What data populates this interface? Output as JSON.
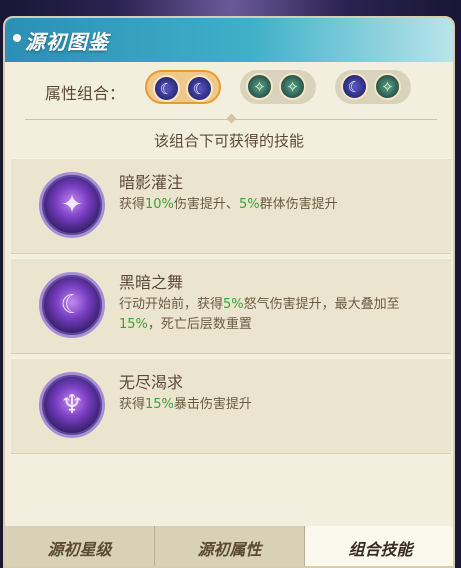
{
  "header": {
    "title": "源初图鉴"
  },
  "attribute": {
    "label": "属性组合：",
    "combos": [
      {
        "orbs": [
          "moon",
          "moon"
        ],
        "selected": true
      },
      {
        "orbs": [
          "star",
          "star"
        ],
        "selected": false
      },
      {
        "orbs": [
          "moon",
          "star"
        ],
        "selected": false
      }
    ]
  },
  "skills": {
    "heading": "该组合下可获得的技能",
    "items": [
      {
        "name": "暗影灌注",
        "icon": "shadow-infusion-icon",
        "desc": [
          {
            "t": "获得"
          },
          {
            "t": "10%",
            "g": true
          },
          {
            "t": "伤害提升、"
          },
          {
            "t": "5%",
            "g": true
          },
          {
            "t": "群体伤害提升"
          }
        ]
      },
      {
        "name": "黑暗之舞",
        "icon": "dark-dance-icon",
        "desc": [
          {
            "t": "行动开始前，获得"
          },
          {
            "t": "5%",
            "g": true
          },
          {
            "t": "怒气伤害提升，最大叠加至"
          },
          {
            "t": "15%",
            "g": true
          },
          {
            "t": "，死亡后层数重置"
          }
        ]
      },
      {
        "name": "无尽渴求",
        "icon": "endless-craving-icon",
        "desc": [
          {
            "t": "获得"
          },
          {
            "t": "15%",
            "g": true
          },
          {
            "t": "暴击伤害提升"
          }
        ]
      }
    ]
  },
  "tabs": [
    {
      "label": "源初星级",
      "active": false
    },
    {
      "label": "源初属性",
      "active": false
    },
    {
      "label": "组合技能",
      "active": true
    }
  ],
  "colors": {
    "accent_green": "#3ca13a",
    "selected_border": "#e79b2f"
  }
}
